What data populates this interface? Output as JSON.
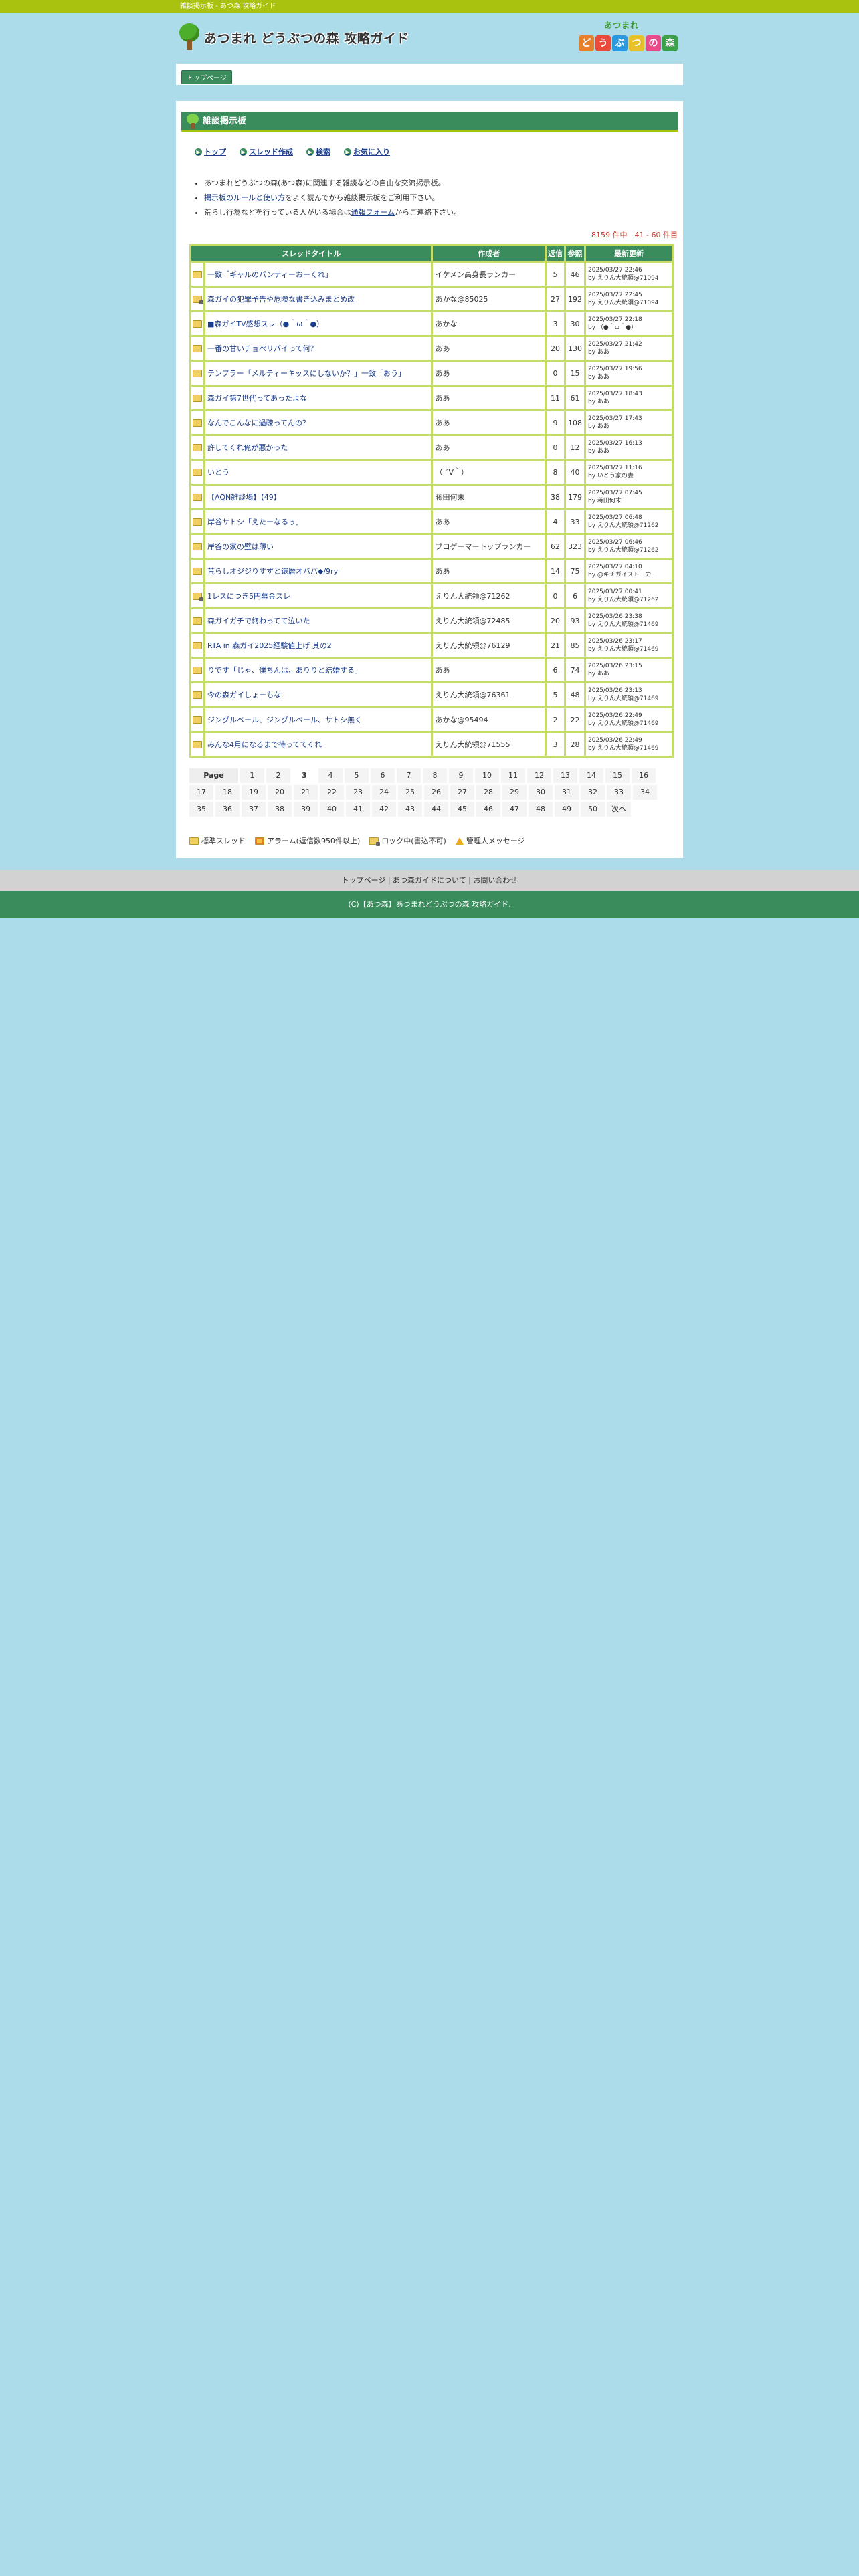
{
  "topbar": {
    "text": "雑談掲示板 - あつ森 攻略ガイド"
  },
  "header": {
    "site_title": "あつまれ どうぶつの森 攻略ガイド",
    "brand_small": "あつまれ",
    "brand_tiles": [
      {
        "ch": "ど",
        "color": "#e8802a"
      },
      {
        "ch": "う",
        "color": "#e94a3a"
      },
      {
        "ch": "ぶ",
        "color": "#2a9ae0"
      },
      {
        "ch": "つ",
        "color": "#e8c02a"
      },
      {
        "ch": "の",
        "color": "#e94a8a"
      },
      {
        "ch": "森",
        "color": "#3aa04a"
      }
    ]
  },
  "breadcrumb": {
    "home": "トップページ"
  },
  "board": {
    "title": "雑談掲示板",
    "nav": {
      "top": "トップ",
      "create": "スレッド作成",
      "search": "検索",
      "favorites": "お気に入り"
    },
    "notes": {
      "n1": "あつまれどうぶつの森(あつ森)に関連する雑談などの自由な交流掲示板。",
      "n2_link": "掲示板のルールと使い方",
      "n2_rest": "をよく読んでから雑談掲示板をご利用下さい。",
      "n3_pre": "荒らし行為などを行っている人がいる場合は",
      "n3_link": "通報フォーム",
      "n3_post": "からご連絡下さい。"
    },
    "count": "8159 件中　41 - 60 件目",
    "columns": {
      "title": "スレッドタイトル",
      "author": "作成者",
      "replies": "返信",
      "views": "参照",
      "updated": "最新更新"
    },
    "threads": [
      {
        "icon": "folder",
        "title": "一致「ギャルのパンティーおーくれ」",
        "author": "イケメン高身長ランカー",
        "replies": "5",
        "views": "46",
        "date": "2025/03/27 22:46",
        "by": "by えりん大統領@71094"
      },
      {
        "icon": "lock",
        "title": "森ガイの犯罪予告や危険な書き込みまとめ改",
        "author": "あかな@85025",
        "replies": "27",
        "views": "192",
        "date": "2025/03/27 22:45",
        "by": "by えりん大統領@71094"
      },
      {
        "icon": "folder",
        "title": "■森ガイTV感想スレ（●＾ω＾●）",
        "author": "あかな",
        "replies": "3",
        "views": "30",
        "date": "2025/03/27 22:18",
        "by": "by （●＾ω＾●）"
      },
      {
        "icon": "folder",
        "title": "一番の甘いチョペリパイって何？",
        "author": "ああ",
        "replies": "20",
        "views": "130",
        "date": "2025/03/27 21:42",
        "by": "by ああ"
      },
      {
        "icon": "folder",
        "title": "テンプラー「メルティーキッスにしないか？」一致「おう」",
        "author": "ああ",
        "replies": "0",
        "views": "15",
        "date": "2025/03/27 19:56",
        "by": "by ああ"
      },
      {
        "icon": "folder",
        "title": "森ガイ第7世代ってあったよな",
        "author": "ああ",
        "replies": "11",
        "views": "61",
        "date": "2025/03/27 18:43",
        "by": "by ああ"
      },
      {
        "icon": "folder",
        "title": "なんでこんなに過疎ってんの？",
        "author": "ああ",
        "replies": "9",
        "views": "108",
        "date": "2025/03/27 17:43",
        "by": "by ああ"
      },
      {
        "icon": "folder",
        "title": "許してくれ俺が悪かった",
        "author": "ああ",
        "replies": "0",
        "views": "12",
        "date": "2025/03/27 16:13",
        "by": "by ああ"
      },
      {
        "icon": "folder",
        "title": "いとう",
        "author": "（ ´∀｀）",
        "replies": "8",
        "views": "40",
        "date": "2025/03/27 11:16",
        "by": "by いとう家の妻"
      },
      {
        "icon": "folder",
        "title": "【AQN雑談場】【49】",
        "author": "蒋田何末",
        "replies": "38",
        "views": "179",
        "date": "2025/03/27 07:45",
        "by": "by 蒋田何末"
      },
      {
        "icon": "folder",
        "title": "岸谷サトシ「えたーなるぅ」",
        "author": "ああ",
        "replies": "4",
        "views": "33",
        "date": "2025/03/27 06:48",
        "by": "by えりん大統領@71262"
      },
      {
        "icon": "folder",
        "title": "岸谷の家の壁は薄い",
        "author": "ブロゲーマートップランカー",
        "replies": "62",
        "views": "323",
        "date": "2025/03/27 06:46",
        "by": "by えりん大統領@71262"
      },
      {
        "icon": "folder",
        "title": "荒らしオジジりすずと還暦オババ◆/9ry",
        "author": "ああ",
        "replies": "14",
        "views": "75",
        "date": "2025/03/27 04:10",
        "by": "by @キチガイストーカー"
      },
      {
        "icon": "lock",
        "title": "1レスにつき5円募金スレ",
        "author": "えりん大統領@71262",
        "replies": "0",
        "views": "6",
        "date": "2025/03/27 00:41",
        "by": "by えりん大統領@71262"
      },
      {
        "icon": "folder",
        "title": "森ガイガチで終わってて泣いた",
        "author": "えりん大統領@72485",
        "replies": "20",
        "views": "93",
        "date": "2025/03/26 23:38",
        "by": "by えりん大統領@71469"
      },
      {
        "icon": "folder",
        "title": "RTA in 森ガイ2025経験値上げ 其の2",
        "author": "えりん大統領@76129",
        "replies": "21",
        "views": "85",
        "date": "2025/03/26 23:17",
        "by": "by えりん大統領@71469"
      },
      {
        "icon": "folder",
        "title": "りです「じゃ、僕ちんは、ありりと結婚する」",
        "author": "ああ",
        "replies": "6",
        "views": "74",
        "date": "2025/03/26 23:15",
        "by": "by ああ"
      },
      {
        "icon": "folder",
        "title": "今の森ガイしょーもな",
        "author": "えりん大統領@76361",
        "replies": "5",
        "views": "48",
        "date": "2025/03/26 23:13",
        "by": "by えりん大統領@71469"
      },
      {
        "icon": "folder",
        "title": "ジングルベール、ジングルベール、サトシ無く",
        "author": "あかな@95494",
        "replies": "2",
        "views": "22",
        "date": "2025/03/26 22:49",
        "by": "by えりん大統領@71469"
      },
      {
        "icon": "folder",
        "title": "みんな4月になるまで待っててくれ",
        "author": "えりん大統領@71555",
        "replies": "3",
        "views": "28",
        "date": "2025/03/26 22:49",
        "by": "by えりん大統領@71469"
      }
    ],
    "pager": {
      "label": "Page",
      "current": "3",
      "rows": [
        [
          "1",
          "2",
          "3",
          "4",
          "5",
          "6",
          "7",
          "8",
          "9",
          "10",
          "11",
          "12",
          "13",
          "14",
          "15",
          "16"
        ],
        [
          "17",
          "18",
          "19",
          "20",
          "21",
          "22",
          "23",
          "24",
          "25",
          "26",
          "27",
          "28",
          "29",
          "30",
          "31",
          "32",
          "33",
          "34"
        ],
        [
          "35",
          "36",
          "37",
          "38",
          "39",
          "40",
          "41",
          "42",
          "43",
          "44",
          "45",
          "46",
          "47",
          "48",
          "49",
          "50",
          "次へ"
        ]
      ]
    },
    "legend": {
      "normal": "標準スレッド",
      "alarm": "アラーム(返信数950件以上)",
      "lock": "ロック中(書込不可)",
      "admin": "管理人メッセージ"
    }
  },
  "footer": {
    "links": [
      "トップページ",
      "あつ森ガイドについて",
      "お問い合わせ"
    ],
    "separator": "|",
    "copyright": "(C)【あつ森】あつまれどうぶつの森 攻略ガイド."
  }
}
